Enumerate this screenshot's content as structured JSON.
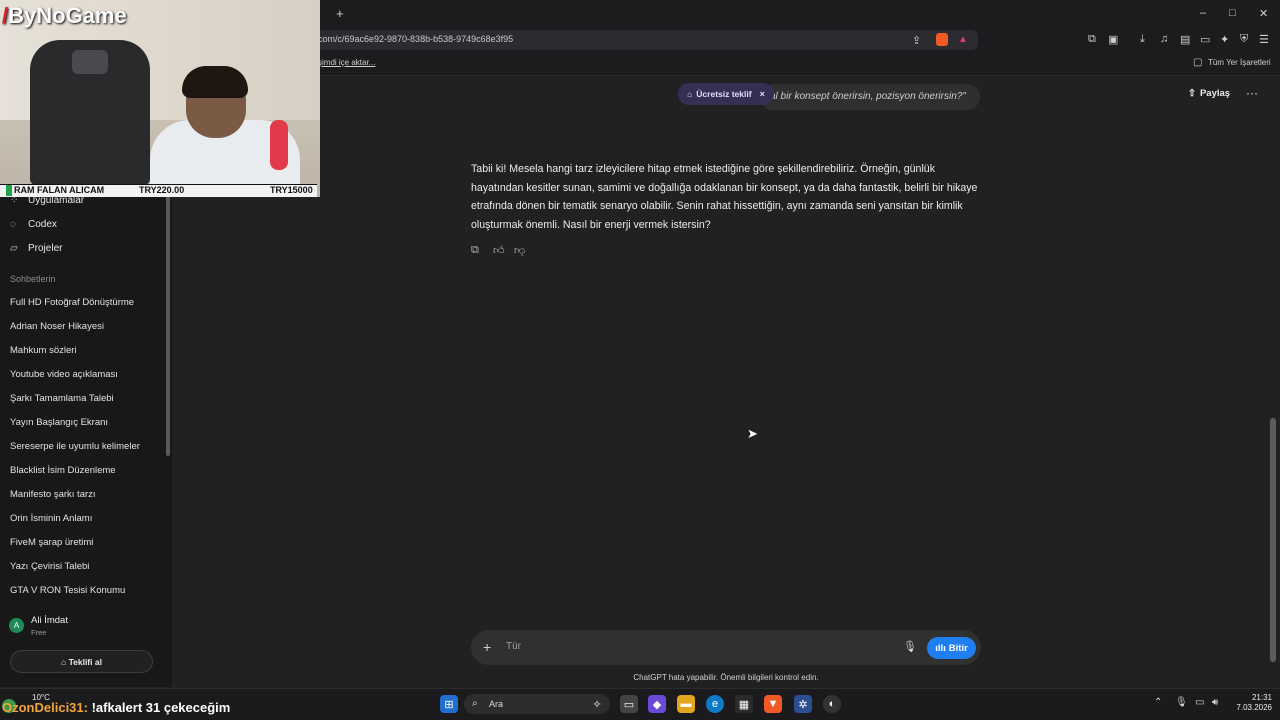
{
  "browser": {
    "new_tab_symbol": "+",
    "url": "com/c/69ac6e92-9870-838b-b538-9749c68e3f95",
    "bookmark_import": "şimdi içe aktar...",
    "all_bookmarks": "Tüm Yer İşaretleri",
    "window_controls": {
      "minimize": "–",
      "maximize": "□",
      "close": "✕"
    }
  },
  "stream_overlay": {
    "logo": "ByNoGame",
    "logo_mark": "/",
    "ticker_left": "RAM FALAN ALICAM",
    "ticker_mid": "TRY220.00",
    "ticker_right": "TRY15000"
  },
  "sidebar": {
    "nav": [
      {
        "label": "Uygulamalar",
        "icon": "apps-icon"
      },
      {
        "label": "Codex",
        "icon": "codex-icon"
      },
      {
        "label": "Projeler",
        "icon": "folder-icon"
      }
    ],
    "section_title": "Sohbetlerin",
    "chats": [
      "Full HD Fotoğraf Dönüştürme",
      "Adrian Noser Hikayesi",
      "Mahkum sözleri",
      "Youtube video açıklaması",
      "Şarkı Tamamlama Talebi",
      "Yayın Başlangıç Ekranı",
      "Sereserpe ile uyumlu kelimeler",
      "Blacklist İsim Düzenleme",
      "Manifesto şarkı tarzı",
      "Orin İsminin Anlamı",
      "FiveM şarap üretimi",
      "Yazı Çevirisi Talebi",
      "GTA V RON Tesisi Konumu"
    ],
    "user": {
      "initial": "A",
      "name": "Ali İmdat",
      "plan": "Free"
    },
    "upgrade_label": "Teklifi al"
  },
  "main": {
    "share_label": "Paylaş",
    "more_label": "···",
    "offer_label": "Ücretsiz teklif",
    "offer_close": "×",
    "previous_user_message": "al bir konsept önerirsin, pozisyon önerirsin?\"",
    "assistant_answer": "Tabii ki! Mesela hangi tarz izleyicilere hitap etmek istediğine göre şekillendirebiliriz. Örneğin, günlük hayatından kesitler sunan, samimi ve doğallığa odaklanan bir konsept, ya da daha fantastik, belirli bir hikaye etrafında dönen bir tematik senaryo olabilir. Senin rahat hissettiğin, aynı zamanda seni yansıtan bir kimlik oluşturmak önemli. Nasıl bir enerji vermek istersin?",
    "composer_placeholder": "Tür",
    "voice_label": "Bitir",
    "disclaimer": "ChatGPT hata yapabilir. Önemli bilgileri kontrol edin."
  },
  "taskbar": {
    "weather": "10°C",
    "chat_user": "OzonDelici31:",
    "chat_message": " !afkalert 31 çekeceğim",
    "search_label": "Ara",
    "time": "21:31",
    "date": "7.03.2026"
  }
}
